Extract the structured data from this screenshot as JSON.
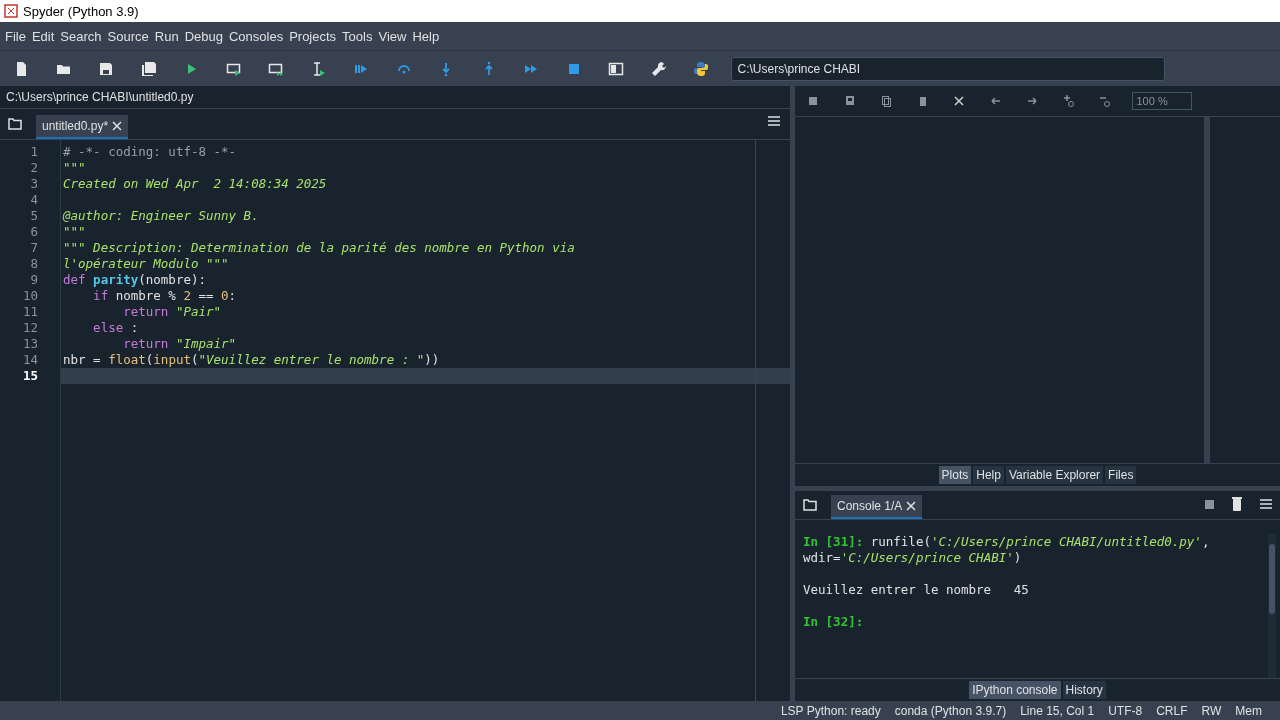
{
  "window": {
    "title": "Spyder (Python 3.9)"
  },
  "menu": [
    "File",
    "Edit",
    "Search",
    "Source",
    "Run",
    "Debug",
    "Consoles",
    "Projects",
    "Tools",
    "View",
    "Help"
  ],
  "toolbar": {
    "working_directory": "C:\\Users\\prince CHABI"
  },
  "editor": {
    "file_path": "C:\\Users\\prince CHABI\\untitled0.py",
    "tabs": [
      {
        "label": "untitled0.py*",
        "selected": true
      }
    ],
    "lines": [
      {
        "number": "1",
        "current": false,
        "tokens": [
          {
            "kind": "comment",
            "text": "# -*- coding: utf-8 -*-"
          }
        ]
      },
      {
        "number": "2",
        "current": false,
        "tokens": [
          {
            "kind": "doc",
            "text": "\"\"\""
          }
        ]
      },
      {
        "number": "3",
        "current": false,
        "tokens": [
          {
            "kind": "doc",
            "text": "Created on Wed Apr  2 14:08:34 2025"
          }
        ]
      },
      {
        "number": "4",
        "current": false
      },
      {
        "number": "5",
        "current": false,
        "tokens": [
          {
            "kind": "doc",
            "text": "@author: Engineer Sunny B."
          }
        ]
      },
      {
        "number": "6",
        "current": false,
        "tokens": [
          {
            "kind": "doc",
            "text": "\"\"\""
          }
        ]
      },
      {
        "number": "7",
        "current": false,
        "tokens": [
          {
            "kind": "doc",
            "text": "\"\"\" Description: Determination de la parité des nombre en Python via"
          }
        ]
      },
      {
        "number": "8",
        "current": false,
        "tokens": [
          {
            "kind": "doc",
            "text": "l'opérateur Modulo \"\"\""
          }
        ]
      },
      {
        "number": "9",
        "current": false,
        "tokens": [
          {
            "kind": "keyword",
            "text": "def "
          },
          {
            "kind": "defname",
            "text": "parity"
          },
          {
            "kind": "plain",
            "text": "(nombre):"
          }
        ]
      },
      {
        "number": "10",
        "current": false,
        "tokens": [
          {
            "kind": "keyword",
            "text": "    if"
          },
          {
            "kind": "plain",
            "text": " nombre % "
          },
          {
            "kind": "number",
            "text": "2"
          },
          {
            "kind": "plain",
            "text": " == "
          },
          {
            "kind": "number",
            "text": "0"
          },
          {
            "kind": "plain",
            "text": ":"
          }
        ]
      },
      {
        "number": "11",
        "current": false,
        "tokens": [
          {
            "kind": "keyword",
            "text": "        return "
          },
          {
            "kind": "string",
            "text": "\"Pair\""
          }
        ]
      },
      {
        "number": "12",
        "current": false,
        "tokens": [
          {
            "kind": "keyword",
            "text": "    else"
          },
          {
            "kind": "plain",
            "text": " :"
          }
        ]
      },
      {
        "number": "13",
        "current": false,
        "tokens": [
          {
            "kind": "keyword",
            "text": "        return "
          },
          {
            "kind": "string",
            "text": "\"Impair\""
          }
        ]
      },
      {
        "number": "14",
        "current": false,
        "tokens": [
          {
            "kind": "plain",
            "text": "nbr = "
          },
          {
            "kind": "builtin",
            "text": "float"
          },
          {
            "kind": "plain",
            "text": "("
          },
          {
            "kind": "builtin",
            "text": "input"
          },
          {
            "kind": "plain",
            "text": "("
          },
          {
            "kind": "string",
            "text": "\"Veuillez entrer le nombre : \""
          },
          {
            "kind": "plain",
            "text": "))"
          }
        ]
      },
      {
        "number": "15",
        "current": true
      }
    ]
  },
  "plots": {
    "zoom": "100 %"
  },
  "pane_tabs": [
    {
      "label": "Plots",
      "selected": true
    },
    {
      "label": "Help",
      "selected": false
    },
    {
      "label": "Variable Explorer",
      "selected": false
    },
    {
      "label": "Files",
      "selected": false
    }
  ],
  "console": {
    "tabs": [
      {
        "label": "Console 1/A",
        "selected": true
      }
    ],
    "blocks": [
      [
        {
          "tokens": [
            {
              "kind": "prompt",
              "text": "In [31]: "
            },
            {
              "kind": "plain",
              "text": "runfile("
            },
            {
              "kind": "string",
              "text": "'C:/Users/prince CHABI/untitled0.py'"
            },
            {
              "kind": "plain",
              "text": ","
            }
          ]
        },
        {
          "tokens": [
            {
              "kind": "plain",
              "text": "wdir="
            },
            {
              "kind": "string",
              "text": "'C:/Users/prince CHABI'"
            },
            {
              "kind": "plain",
              "text": ")"
            }
          ]
        }
      ],
      [
        {
          "tokens": [
            {
              "kind": "plain",
              "text": "Veuillez entrer le nombre   45"
            }
          ]
        }
      ],
      [
        {
          "tokens": [
            {
              "kind": "prompt",
              "text": "In [32]: "
            }
          ]
        }
      ]
    ]
  },
  "console_tabs": [
    {
      "label": "IPython console",
      "selected": true
    },
    {
      "label": "History",
      "selected": false
    }
  ],
  "status_bar": [
    "LSP Python: ready",
    "conda (Python 3.9.7)",
    "Line 15, Col 1",
    "UTF-8",
    "CRLF",
    "RW",
    "Mem"
  ]
}
